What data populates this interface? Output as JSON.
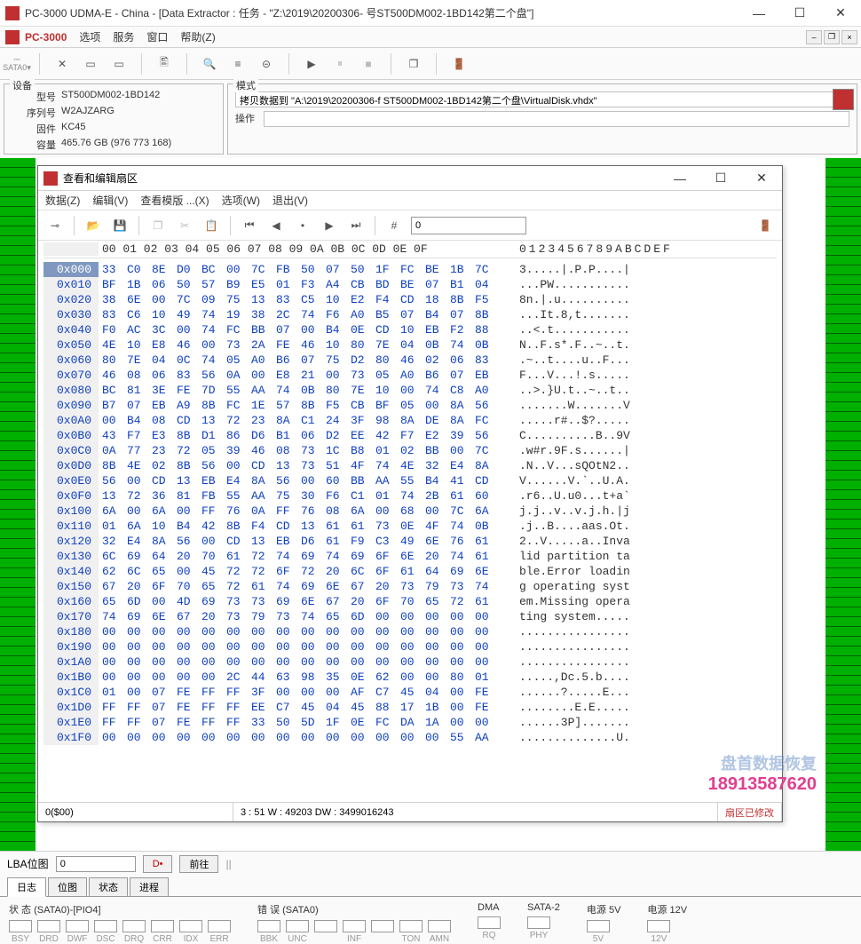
{
  "title": "PC-3000 UDMA-E - China - [Data Extractor : 任务 - \"Z:\\2019\\20200306-     号ST500DM002-1BD142第二个盘\"]",
  "menubar": {
    "brand": "PC-3000",
    "items": [
      "选项",
      "服务",
      "窗口",
      "帮助(Z)"
    ]
  },
  "sata_label": "SATA0",
  "device": {
    "label": "设备",
    "model_label": "型号",
    "model": "ST500DM002-1BD142",
    "serial_label": "序列号",
    "serial": "W2AJZARG",
    "fw_label": "固件",
    "fw": "KC45",
    "cap_label": "容量",
    "cap": "465.76 GB (976 773 168)"
  },
  "mode": {
    "label": "模式",
    "copy": "拷贝数据到 \"A:\\2019\\20200306-f      ST500DM002-1BD142第二个盘\\VirtualDisk.vhdx\"",
    "op_label": "操作"
  },
  "hexwin": {
    "title": "查看和编辑扇区",
    "menu": [
      "数据(Z)",
      "编辑(V)",
      "查看模版 ...(X)",
      "选项(W)",
      "退出(V)"
    ],
    "search_value": "0",
    "header_offsets": "00 01 02 03 04 05 06 07 08 09 0A 0B 0C 0D 0E 0F",
    "header_ascii": "0123456789ABCDEF",
    "status_left": "0($00)",
    "status_mid": "3 : 51 W : 49203 DW : 3499016243",
    "status_right": "扇区已修改",
    "rows": [
      {
        "a": "0x000",
        "h": "33 C0 8E D0 BC 00 7C FB 50 07 50 1F FC BE 1B 7C",
        "t": "3.....|.P.P....|"
      },
      {
        "a": "0x010",
        "h": "BF 1B 06 50 57 B9 E5 01 F3 A4 CB BD BE 07 B1 04",
        "t": "...PW..........."
      },
      {
        "a": "0x020",
        "h": "38 6E 00 7C 09 75 13 83 C5 10 E2 F4 CD 18 8B F5",
        "t": "8n.|.u.........."
      },
      {
        "a": "0x030",
        "h": "83 C6 10 49 74 19 38 2C 74 F6 A0 B5 07 B4 07 8B",
        "t": "...It.8,t......."
      },
      {
        "a": "0x040",
        "h": "F0 AC 3C 00 74 FC BB 07 00 B4 0E CD 10 EB F2 88",
        "t": "..<.t..........."
      },
      {
        "a": "0x050",
        "h": "4E 10 E8 46 00 73 2A FE 46 10 80 7E 04 0B 74 0B",
        "t": "N..F.s*.F..~..t."
      },
      {
        "a": "0x060",
        "h": "80 7E 04 0C 74 05 A0 B6 07 75 D2 80 46 02 06 83",
        "t": ".~..t....u..F..."
      },
      {
        "a": "0x070",
        "h": "46 08 06 83 56 0A 00 E8 21 00 73 05 A0 B6 07 EB",
        "t": "F...V...!.s....."
      },
      {
        "a": "0x080",
        "h": "BC 81 3E FE 7D 55 AA 74 0B 80 7E 10 00 74 C8 A0",
        "t": "..>.}U.t..~..t.."
      },
      {
        "a": "0x090",
        "h": "B7 07 EB A9 8B FC 1E 57 8B F5 CB BF 05 00 8A 56",
        "t": ".......W.......V"
      },
      {
        "a": "0x0A0",
        "h": "00 B4 08 CD 13 72 23 8A C1 24 3F 98 8A DE 8A FC",
        "t": ".....r#..$?....."
      },
      {
        "a": "0x0B0",
        "h": "43 F7 E3 8B D1 86 D6 B1 06 D2 EE 42 F7 E2 39 56",
        "t": "C..........B..9V"
      },
      {
        "a": "0x0C0",
        "h": "0A 77 23 72 05 39 46 08 73 1C B8 01 02 BB 00 7C",
        "t": ".w#r.9F.s......|"
      },
      {
        "a": "0x0D0",
        "h": "8B 4E 02 8B 56 00 CD 13 73 51 4F 74 4E 32 E4 8A",
        "t": ".N..V...sQOtN2.."
      },
      {
        "a": "0x0E0",
        "h": "56 00 CD 13 EB E4 8A 56 00 60 BB AA 55 B4 41 CD",
        "t": "V......V.`..U.A."
      },
      {
        "a": "0x0F0",
        "h": "13 72 36 81 FB 55 AA 75 30 F6 C1 01 74 2B 61 60",
        "t": ".r6..U.u0...t+a`"
      },
      {
        "a": "0x100",
        "h": "6A 00 6A 00 FF 76 0A FF 76 08 6A 00 68 00 7C 6A",
        "t": "j.j..v..v.j.h.|j"
      },
      {
        "a": "0x110",
        "h": "01 6A 10 B4 42 8B F4 CD 13 61 61 73 0E 4F 74 0B",
        "t": ".j..B....aas.Ot."
      },
      {
        "a": "0x120",
        "h": "32 E4 8A 56 00 CD 13 EB D6 61 F9 C3 49 6E 76 61",
        "t": "2..V.....a..Inva"
      },
      {
        "a": "0x130",
        "h": "6C 69 64 20 70 61 72 74 69 74 69 6F 6E 20 74 61",
        "t": "lid partition ta"
      },
      {
        "a": "0x140",
        "h": "62 6C 65 00 45 72 72 6F 72 20 6C 6F 61 64 69 6E",
        "t": "ble.Error loadin"
      },
      {
        "a": "0x150",
        "h": "67 20 6F 70 65 72 61 74 69 6E 67 20 73 79 73 74",
        "t": "g operating syst"
      },
      {
        "a": "0x160",
        "h": "65 6D 00 4D 69 73 73 69 6E 67 20 6F 70 65 72 61",
        "t": "em.Missing opera"
      },
      {
        "a": "0x170",
        "h": "74 69 6E 67 20 73 79 73 74 65 6D 00 00 00 00 00",
        "t": "ting system....."
      },
      {
        "a": "0x180",
        "h": "00 00 00 00 00 00 00 00 00 00 00 00 00 00 00 00",
        "t": "................"
      },
      {
        "a": "0x190",
        "h": "00 00 00 00 00 00 00 00 00 00 00 00 00 00 00 00",
        "t": "................"
      },
      {
        "a": "0x1A0",
        "h": "00 00 00 00 00 00 00 00 00 00 00 00 00 00 00 00",
        "t": "................"
      },
      {
        "a": "0x1B0",
        "h": "00 00 00 00 00 2C 44 63 98 35 0E 62 00 00 80 01",
        "t": ".....,Dc.5.b...."
      },
      {
        "a": "0x1C0",
        "h": "01 00 07 FE FF FF 3F 00 00 00 AF C7 45 04 00 FE",
        "t": "......?.....E..."
      },
      {
        "a": "0x1D0",
        "h": "FF FF 07 FE FF FF EE C7 45 04 45 88 17 1B 00 FE",
        "t": "........E.E....."
      },
      {
        "a": "0x1E0",
        "h": "FF FF 07 FE FF FF 33 50 5D 1F 0E FC DA 1A 00 00",
        "t": "......3P]......."
      },
      {
        "a": "0x1F0",
        "h": "00 00 00 00 00 00 00 00 00 00 00 00 00 00 55 AA",
        "t": "..............U."
      }
    ]
  },
  "lba": {
    "label": "LBA位图",
    "value": "0",
    "goto": "前往"
  },
  "tabs": [
    "日志",
    "位图",
    "状态",
    "进程"
  ],
  "status": {
    "group1": {
      "label": "状 态 (SATA0)-[PIO4]",
      "leds": [
        "BSY",
        "DRD",
        "DWF",
        "DSC",
        "DRQ",
        "CRR",
        "IDX",
        "ERR"
      ]
    },
    "group2": {
      "label": "错 误 (SATA0)",
      "leds": [
        "BBK",
        "UNC",
        "",
        "INF",
        "",
        "TON",
        "AMN"
      ]
    },
    "group3": {
      "label": "DMA",
      "leds": [
        "RQ"
      ]
    },
    "group4": {
      "label": "SATA-2",
      "leds": [
        "PHY"
      ]
    },
    "group5": {
      "label": "电源 5V",
      "leds": [
        "5V"
      ]
    },
    "group6": {
      "label": "电源 12V",
      "leds": [
        "12V"
      ]
    }
  },
  "watermark": {
    "text": "盘首数据恢复",
    "phone": "18913587620"
  }
}
